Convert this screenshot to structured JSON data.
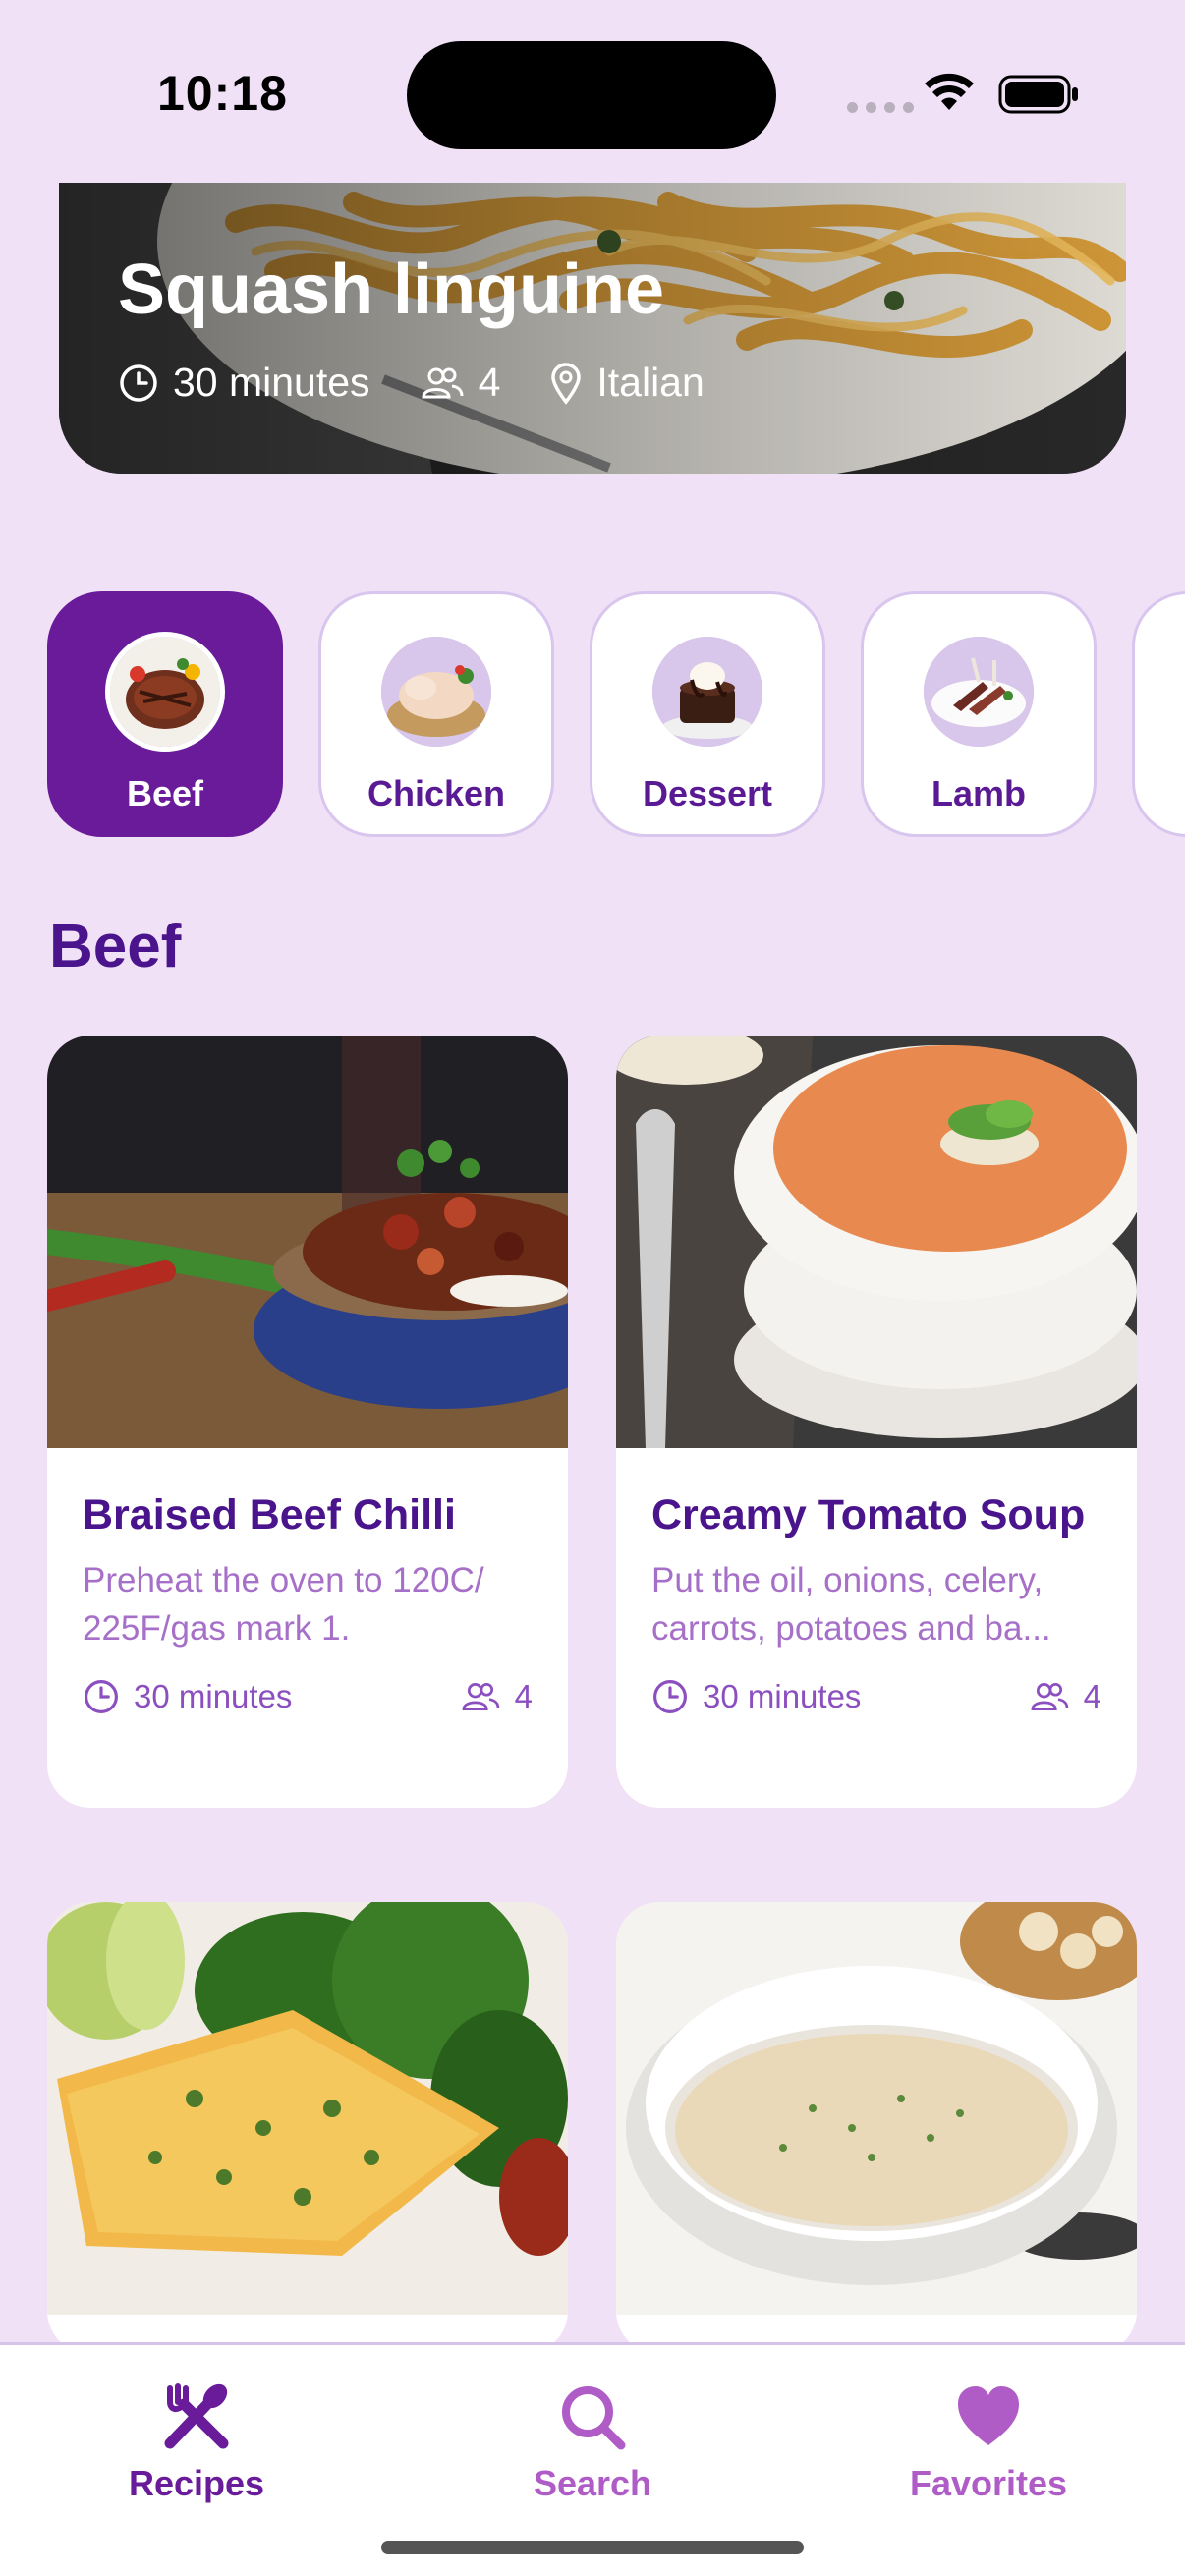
{
  "status": {
    "time": "10:18"
  },
  "hero": {
    "title": "Squash linguine",
    "time": "30 minutes",
    "servings": "4",
    "cuisine": "Italian"
  },
  "categories": [
    {
      "label": "Beef",
      "active": true
    },
    {
      "label": "Chicken",
      "active": false
    },
    {
      "label": "Dessert",
      "active": false
    },
    {
      "label": "Lamb",
      "active": false
    }
  ],
  "section_title": "Beef",
  "recipes": [
    {
      "title": "Braised Beef Chilli",
      "description": "Preheat the oven to 120C/ 225F/gas mark 1.",
      "time": "30 minutes",
      "servings": "4"
    },
    {
      "title": "Creamy Tomato Soup",
      "description": "Put the oil, onions, celery, carrots, potatoes and ba...",
      "time": "30 minutes",
      "servings": "4"
    }
  ],
  "tabs": [
    {
      "label": "Recipes",
      "icon": "utensils-icon",
      "active": true
    },
    {
      "label": "Search",
      "icon": "search-icon",
      "active": false
    },
    {
      "label": "Favorites",
      "icon": "heart-icon",
      "active": false
    }
  ],
  "colors": {
    "background": "#f1e1f6",
    "accent": "#6a1b9a",
    "title_purple": "#4a148c",
    "inactive_tab": "#b05cc7"
  }
}
